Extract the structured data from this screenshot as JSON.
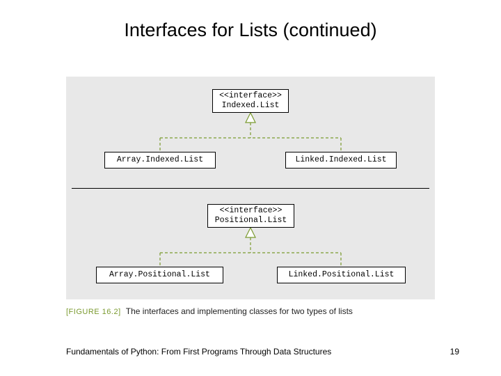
{
  "title": "Interfaces for Lists (continued)",
  "diagram": {
    "interface1": {
      "stereotype": "<<interface>>",
      "name": "Indexed.List"
    },
    "impl1a": "Array.Indexed.List",
    "impl1b": "Linked.Indexed.List",
    "interface2": {
      "stereotype": "<<interface>>",
      "name": "Positional.List"
    },
    "impl2a": "Array.Positional.List",
    "impl2b": "Linked.Positional.List"
  },
  "caption": {
    "label": "[FIGURE 16.2]",
    "text": "The interfaces and implementing classes for two types of lists"
  },
  "footer": "Fundamentals of Python: From First Programs Through Data Structures",
  "page": "19"
}
